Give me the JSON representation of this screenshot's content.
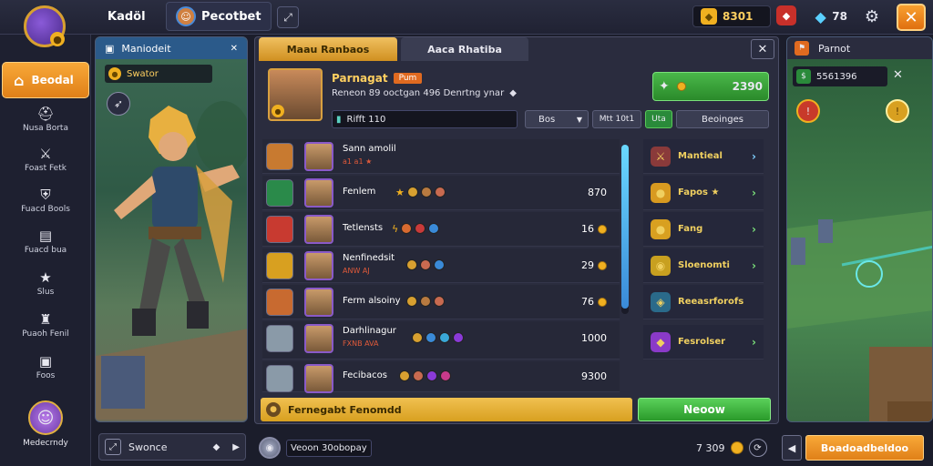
{
  "topbar": {
    "tab1_label": "Kadöl",
    "tab2_label": "Pecotbet",
    "currency1": "8301",
    "currency2": "78"
  },
  "sidebar": {
    "home_label": "Beodal",
    "items": [
      {
        "label": "Nusa Borta",
        "icon": "helmet-icon"
      },
      {
        "label": "Foast Fetk",
        "icon": "sword-icon"
      },
      {
        "label": "Fuacd Bools",
        "icon": "shield-icon"
      },
      {
        "label": "Fuacd bua",
        "icon": "chart-icon"
      },
      {
        "label": "Slus",
        "icon": "star-icon"
      },
      {
        "label": "Puaoh Fenil",
        "icon": "bag-icon"
      },
      {
        "label": "Foos",
        "icon": "chest-icon"
      }
    ],
    "profile_label": "Medecrndy"
  },
  "hero_panel": {
    "title": "Maniodeit",
    "subtitle": "Swator",
    "footer_label": "Swonce"
  },
  "center": {
    "tab_active": "Maau Ranbaos",
    "tab_inactive": "Aaca Rhatiba",
    "hero_name": "Parnagat",
    "hero_badge": "Pum",
    "hero_desc": "Reneon 89 ooctgan 496 Denrtng ynar",
    "search_value": "Rifft 110",
    "filter1": "Bos",
    "filter2": "Mtt 10t1",
    "filter3": "Uta",
    "filter_btn": "Beoinges",
    "reward_value": "2390",
    "rows": [
      {
        "name": "Sann amolil",
        "sub": "a1 a1 ★",
        "value": "",
        "icon_color": "#c87a30"
      },
      {
        "name": "Fenlem",
        "sub": "",
        "value": "870",
        "icon_color": "#2a8a4a"
      },
      {
        "name": "Tetlensts",
        "sub": "",
        "value": "16",
        "icon_color": "#c83a30"
      },
      {
        "name": "Nenfinedsit",
        "sub": "ANW AJ",
        "value": "29",
        "icon_color": "#d8a020"
      },
      {
        "name": "Ferm alsoiny",
        "sub": "",
        "value": "76",
        "icon_color": "#c86a30"
      },
      {
        "name": "Darhlinagur",
        "sub": "FXNB AVA",
        "value": "1000",
        "icon_color": "#8a9aa8"
      },
      {
        "name": "Fecibacos",
        "sub": "",
        "value": "9300",
        "icon_color": "#8a9aa8"
      }
    ],
    "side_items": [
      {
        "label": "Mantieal",
        "icon": "swords-icon"
      },
      {
        "label": "Fapos ★",
        "icon": "coin-icon"
      },
      {
        "label": "Fang",
        "icon": "coin-stack-icon"
      },
      {
        "label": "Sloenomti",
        "icon": "gold-orb-icon"
      },
      {
        "label": "Reeasrforofs",
        "icon": "rune-icon"
      },
      {
        "label": "Fesrolser",
        "icon": "crystal-icon"
      }
    ],
    "bottom_bar_label": "Fernegabt Fenomdd",
    "bottom_btn": "Neoow"
  },
  "right_panel": {
    "title": "Parnot",
    "value": "5561396"
  },
  "bottom": {
    "input_value": "Veoon 30obopay",
    "gold": "7 309",
    "action_btn": "Boadoadbeldoo"
  },
  "colors": {
    "accent_orange": "#f0a020",
    "accent_green": "#3aa83a",
    "panel_bg": "#2a2c3e"
  }
}
